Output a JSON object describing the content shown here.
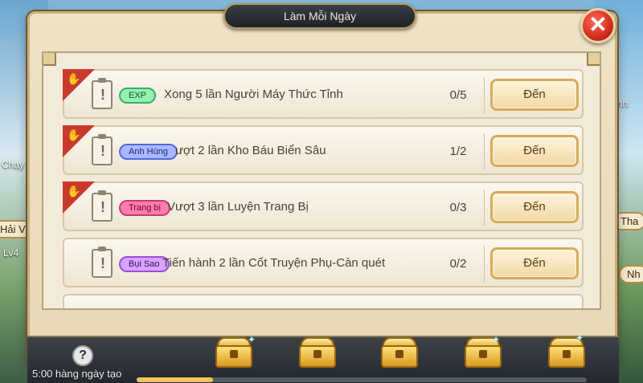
{
  "dialog": {
    "title": "Làm Mỗi Ngày",
    "close_icon": "close-icon"
  },
  "background": {
    "left_labels": [
      "Chạy t",
      "Hải V",
      "Lv4"
    ],
    "right_labels": [
      "nh",
      "Tha",
      "Nh"
    ]
  },
  "tasks": [
    {
      "tag": "EXP",
      "tag_type": "exp",
      "text": "Xong 5 lần Người Máy Thức Tỉnh",
      "progress": "0/5",
      "button": "Đến",
      "has_ribbon": true
    },
    {
      "tag": "Anh Hùng",
      "tag_type": "hero",
      "text": "ượt 2 lần Kho Báu Biển Sâu",
      "progress": "1/2",
      "button": "Đến",
      "has_ribbon": true
    },
    {
      "tag": "Trang bị",
      "tag_type": "equip",
      "text": "Vượt 3 lần Luyện Trang Bị",
      "progress": "0/3",
      "button": "Đến",
      "has_ribbon": true
    },
    {
      "tag": "Bụi Sao",
      "tag_type": "dust",
      "text": "Tiến hành 2 lần Cốt Truyện Phụ-Càn quét",
      "progress": "0/2",
      "button": "Đến",
      "has_ribbon": false
    }
  ],
  "footer": {
    "help_label": "?",
    "reset_text": "5:00 hàng ngày tạo",
    "progress_fraction": 0.17,
    "chests": 5,
    "colors": {
      "progress_fill": "#f2c45a"
    }
  }
}
